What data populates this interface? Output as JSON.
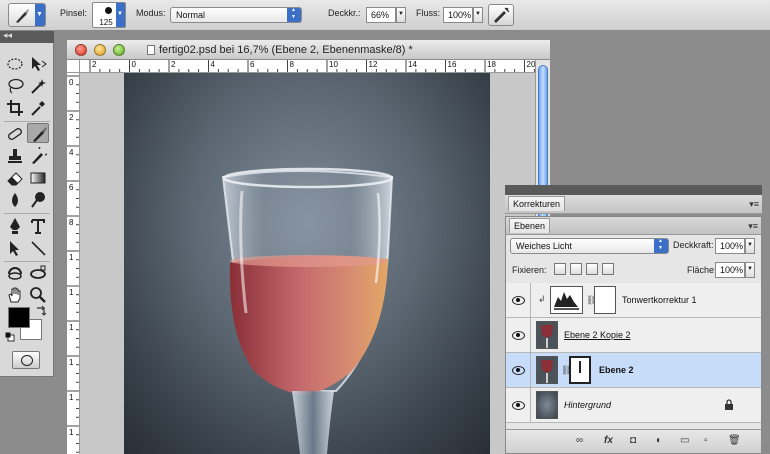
{
  "options_bar": {
    "brush_label": "Pinsel:",
    "brush_size": "125",
    "mode_label": "Modus:",
    "mode_value": "Normal",
    "opacity_label": "Deckkr.:",
    "opacity_value": "66%",
    "flow_label": "Fluss:",
    "flow_value": "100%"
  },
  "tools_panel": {
    "collapse_glyph": "◂◂",
    "tools": [
      "marquee-icon",
      "move-icon",
      "lasso-icon",
      "magic-wand-icon",
      "crop-icon",
      "eyedropper-icon",
      "spot-healing-icon",
      "brush-icon",
      "clone-stamp-icon",
      "history-brush-icon",
      "eraser-icon",
      "gradient-icon",
      "blur-icon",
      "dodge-icon",
      "pen-icon",
      "type-icon",
      "path-selection-icon",
      "line-icon",
      "rotate-view-icon",
      "3d-orbit-icon",
      "hand-icon",
      "zoom-icon"
    ],
    "foreground_color": "#000000",
    "background_color": "#ffffff"
  },
  "document": {
    "title": "fertig02.psd bei 16,7% (Ebene 2, Ebenenmaske/8) *",
    "ruler_h_labels": [
      "2",
      "0",
      "2",
      "4",
      "6",
      "8",
      "10",
      "12",
      "14",
      "16",
      "18",
      "20"
    ],
    "ruler_v_labels": [
      "0",
      "2",
      "4",
      "6",
      "8",
      "1",
      "1",
      "1",
      "1",
      "1",
      "1"
    ]
  },
  "panels": {
    "korrekturen_tab": "Korrekturen",
    "ebenen_tab": "Ebenen",
    "menu_glyph": "▾≡",
    "blend_mode": "Weiches Licht",
    "opacity_label": "Deckkraft:",
    "opacity_value": "100%",
    "lock_label": "Fixieren:",
    "fill_label": "Fläche:",
    "fill_value": "100%",
    "layers": [
      {
        "name": "Tonwertkorrektur 1",
        "selected": false
      },
      {
        "name": "Ebene 2 Kopie 2",
        "selected": false
      },
      {
        "name": "Ebene 2",
        "selected": true
      },
      {
        "name": "Hintergrund",
        "selected": false
      }
    ],
    "footer_icons": [
      "link-layers-icon",
      "fx-icon",
      "add-mask-icon",
      "adjustment-layer-icon",
      "group-icon",
      "new-layer-icon",
      "trash-icon"
    ],
    "footer_glyphs": [
      "∞",
      "fx",
      "◘",
      "◐",
      "▭",
      "▫",
      "🗑"
    ]
  }
}
